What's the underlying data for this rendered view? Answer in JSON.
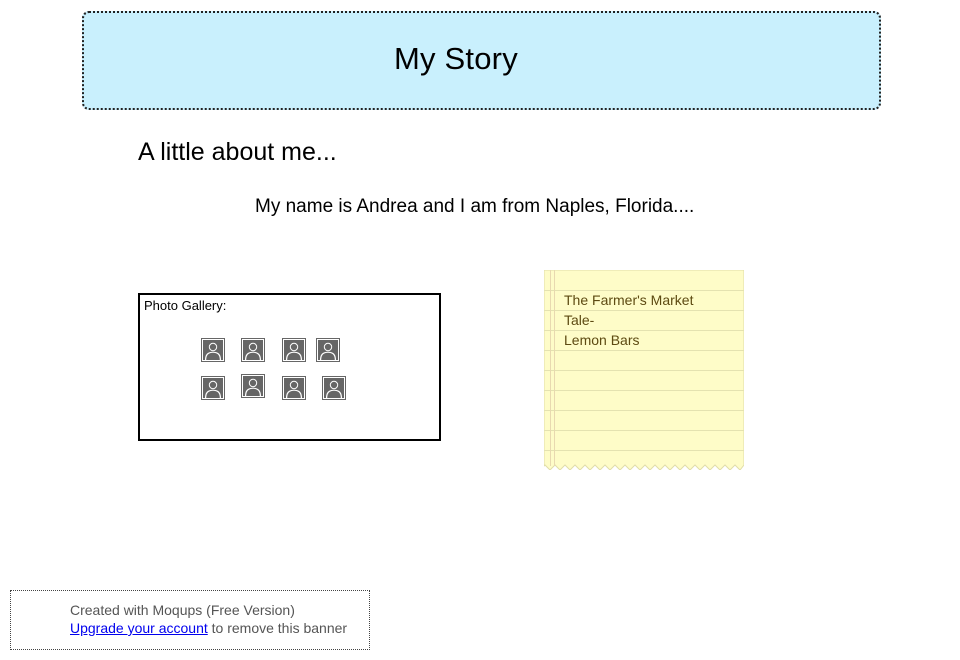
{
  "header": {
    "title": "My Story"
  },
  "about": {
    "heading": "A little about me...",
    "intro": "My name is Andrea and I am from Naples, Florida...."
  },
  "gallery": {
    "label": "Photo Gallery:",
    "photo_icon": "person-photo-placeholder-icon",
    "photo_count": 8
  },
  "note": {
    "lines": [
      "The Farmer's Market",
      "Tale-",
      "Lemon Bars"
    ],
    "colors": {
      "paper": "#fefcc8",
      "rule": "#e4e2b0",
      "text": "#5d4a12"
    }
  },
  "banner": {
    "line1": "Created with Moqups (Free Version)",
    "link": "Upgrade your account",
    "line2_suffix": " to remove this banner"
  },
  "colors": {
    "header_bg": "#c9f0fd",
    "link": "#0000ee",
    "icon": "#666666"
  }
}
